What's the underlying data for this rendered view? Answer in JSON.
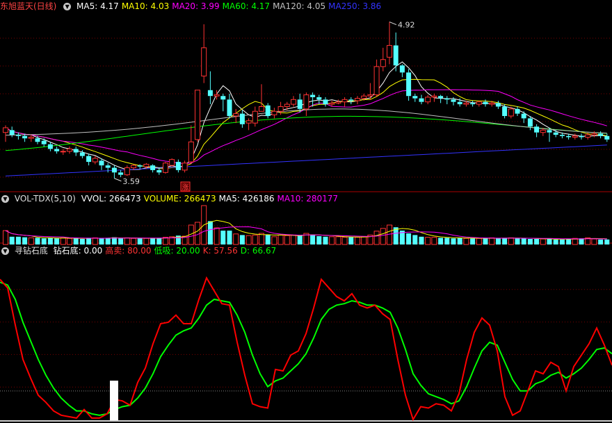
{
  "legends": {
    "main": {
      "stock": "东旭蓝天(日线)",
      "items": [
        {
          "label": "MA5:",
          "value": "4.17",
          "color": "#ffffff"
        },
        {
          "label": "MA10:",
          "value": "4.03",
          "color": "#ffff00"
        },
        {
          "label": "MA20:",
          "value": "3.99",
          "color": "#ff00ff"
        },
        {
          "label": "MA60:",
          "value": "4.17",
          "color": "#00ff00"
        },
        {
          "label": "MA120:",
          "value": "4.05",
          "color": "#c0c0c0"
        },
        {
          "label": "MA250:",
          "value": "3.86",
          "color": "#3333ff"
        }
      ]
    },
    "vol": {
      "name": "VOL-TDX(5,10)",
      "items": [
        {
          "label": "VVOL:",
          "value": "266473",
          "color": "#ffffff"
        },
        {
          "label": "VOLUME:",
          "value": "266473",
          "color": "#ffff00"
        },
        {
          "label": "MA5:",
          "value": "426186",
          "color": "#ffffff"
        },
        {
          "label": "MA10:",
          "value": "280177",
          "color": "#ff00ff"
        }
      ]
    },
    "ind": {
      "name": "寻钻石底",
      "items": [
        {
          "label": "钻石底:",
          "value": "0.00",
          "color": "#ffffff"
        },
        {
          "label": "高卖:",
          "value": "80.00",
          "color": "#ff3333"
        },
        {
          "label": "低吸:",
          "value": "20.00",
          "color": "#00ff00"
        },
        {
          "label": "K:",
          "value": "57.56",
          "color": "#ff3333"
        },
        {
          "label": "D:",
          "value": "66.67",
          "color": "#00ff00"
        }
      ]
    }
  },
  "annotations": {
    "high": "4.92",
    "low": "3.59",
    "zhang": "涨"
  },
  "colors": {
    "up": "#ff3232",
    "down": "#54ffff",
    "k": "#ff0000",
    "d": "#00ff00",
    "ma5": "#ffffff",
    "ma10": "#ffff00",
    "ma20": "#ff00ff",
    "ma60": "#00ff00",
    "ma120": "#c0c0c0",
    "ma250": "#3333ff"
  },
  "chart_data": {
    "type": "candlestick",
    "price_range": [
      3.5,
      5.0
    ],
    "candles": [
      [
        3.98,
        4.02,
        3.9,
        4.04
      ],
      [
        4.0,
        3.96,
        3.94,
        4.03
      ],
      [
        3.96,
        3.95,
        3.92,
        3.98
      ],
      [
        3.95,
        3.93,
        3.9,
        3.97
      ],
      [
        3.93,
        3.94,
        3.9,
        3.96
      ],
      [
        3.93,
        3.9,
        3.88,
        3.95
      ],
      [
        3.91,
        3.88,
        3.86,
        3.93
      ],
      [
        3.88,
        3.84,
        3.82,
        3.9
      ],
      [
        3.84,
        3.82,
        3.8,
        3.86
      ],
      [
        3.82,
        3.82,
        3.79,
        3.84
      ],
      [
        3.82,
        3.84,
        3.8,
        3.86
      ],
      [
        3.84,
        3.81,
        3.78,
        3.86
      ],
      [
        3.81,
        3.78,
        3.76,
        3.83
      ],
      [
        3.78,
        3.73,
        3.7,
        3.8
      ],
      [
        3.73,
        3.76,
        3.71,
        3.78
      ],
      [
        3.74,
        3.7,
        3.66,
        3.76
      ],
      [
        3.7,
        3.68,
        3.64,
        3.72
      ],
      [
        3.68,
        3.64,
        3.59,
        3.7
      ],
      [
        3.64,
        3.62,
        3.6,
        3.66
      ],
      [
        3.62,
        3.68,
        3.61,
        3.7
      ],
      [
        3.68,
        3.7,
        3.66,
        3.71
      ],
      [
        3.7,
        3.69,
        3.67,
        3.71
      ],
      [
        3.69,
        3.71,
        3.67,
        3.72
      ],
      [
        3.7,
        3.66,
        3.64,
        3.71
      ],
      [
        3.66,
        3.64,
        3.62,
        3.68
      ],
      [
        3.64,
        3.72,
        3.63,
        3.73
      ],
      [
        3.7,
        3.75,
        3.69,
        3.76
      ],
      [
        3.73,
        3.66,
        3.64,
        3.75
      ],
      [
        3.66,
        3.72,
        3.64,
        3.74
      ],
      [
        3.73,
        3.9,
        3.72,
        4.04
      ],
      [
        3.92,
        4.34,
        3.9,
        4.34
      ],
      [
        4.46,
        4.7,
        4.4,
        4.9
      ],
      [
        4.34,
        4.29,
        4.22,
        4.5
      ],
      [
        4.29,
        4.3,
        4.26,
        4.34
      ],
      [
        4.29,
        4.26,
        4.16,
        4.31
      ],
      [
        4.26,
        4.12,
        4.1,
        4.31
      ],
      [
        4.12,
        4.14,
        4.06,
        4.18
      ],
      [
        4.14,
        4.05,
        4.02,
        4.17
      ],
      [
        4.06,
        4.08,
        4.0,
        4.1
      ],
      [
        4.06,
        4.16,
        4.03,
        4.2
      ],
      [
        4.16,
        4.2,
        4.16,
        4.39
      ],
      [
        4.21,
        4.12,
        4.1,
        4.23
      ],
      [
        4.13,
        4.16,
        4.1,
        4.19
      ],
      [
        4.16,
        4.2,
        4.13,
        4.24
      ],
      [
        4.2,
        4.22,
        4.17,
        4.24
      ],
      [
        4.22,
        4.26,
        4.2,
        4.29
      ],
      [
        4.26,
        4.18,
        4.15,
        4.31
      ],
      [
        4.18,
        4.3,
        4.12,
        4.32
      ],
      [
        4.3,
        4.28,
        4.2,
        4.32
      ],
      [
        4.28,
        4.26,
        4.22,
        4.3
      ],
      [
        4.26,
        4.22,
        4.2,
        4.28
      ],
      [
        4.22,
        4.23,
        4.2,
        4.25
      ],
      [
        4.23,
        4.24,
        4.22,
        4.26
      ],
      [
        4.24,
        4.26,
        4.2,
        4.28
      ],
      [
        4.26,
        4.25,
        4.22,
        4.28
      ],
      [
        4.25,
        4.27,
        4.22,
        4.29
      ],
      [
        4.27,
        4.29,
        4.25,
        4.31
      ],
      [
        4.29,
        4.3,
        4.26,
        4.4
      ],
      [
        4.3,
        4.54,
        4.28,
        4.6
      ],
      [
        4.54,
        4.6,
        4.5,
        4.7
      ],
      [
        4.62,
        4.72,
        4.56,
        4.92
      ],
      [
        4.72,
        4.55,
        4.5,
        4.83
      ],
      [
        4.55,
        4.49,
        4.45,
        4.56
      ],
      [
        4.49,
        4.29,
        4.25,
        4.52
      ],
      [
        4.29,
        4.27,
        4.24,
        4.31
      ],
      [
        4.27,
        4.24,
        4.22,
        4.3
      ],
      [
        4.24,
        4.28,
        4.22,
        4.3
      ],
      [
        4.28,
        4.29,
        4.24,
        4.31
      ],
      [
        4.29,
        4.27,
        4.23,
        4.3
      ],
      [
        4.27,
        4.26,
        4.22,
        4.29
      ],
      [
        4.26,
        4.24,
        4.21,
        4.28
      ],
      [
        4.24,
        4.22,
        4.2,
        4.27
      ],
      [
        4.22,
        4.23,
        4.2,
        4.25
      ],
      [
        4.23,
        4.22,
        4.2,
        4.25
      ],
      [
        4.22,
        4.24,
        4.2,
        4.25
      ],
      [
        4.24,
        4.22,
        4.2,
        4.26
      ],
      [
        4.22,
        4.23,
        4.2,
        4.25
      ],
      [
        4.23,
        4.2,
        4.18,
        4.25
      ],
      [
        4.2,
        4.12,
        4.1,
        4.22
      ],
      [
        4.12,
        4.18,
        4.1,
        4.2
      ],
      [
        4.18,
        4.14,
        4.12,
        4.2
      ],
      [
        4.14,
        4.1,
        4.06,
        4.16
      ],
      [
        4.1,
        4.03,
        4.0,
        4.12
      ],
      [
        4.03,
        3.98,
        3.94,
        4.05
      ],
      [
        3.98,
        4.0,
        3.95,
        4.02
      ],
      [
        4.0,
        3.98,
        3.9,
        4.02
      ],
      [
        3.98,
        3.96,
        3.94,
        4.0
      ],
      [
        3.96,
        3.95,
        3.93,
        3.98
      ],
      [
        3.95,
        3.94,
        3.92,
        3.97
      ],
      [
        3.94,
        3.95,
        3.92,
        3.97
      ],
      [
        3.95,
        3.94,
        3.92,
        3.97
      ],
      [
        3.94,
        3.96,
        3.92,
        3.98
      ],
      [
        3.96,
        3.97,
        3.94,
        3.99
      ],
      [
        3.97,
        3.95,
        3.93,
        3.99
      ],
      [
        3.95,
        3.92,
        3.9,
        3.97
      ]
    ],
    "volume": [
      50,
      28,
      28,
      26,
      24,
      24,
      22,
      24,
      22,
      24,
      22,
      22,
      20,
      24,
      24,
      22,
      24,
      26,
      22,
      24,
      22,
      22,
      22,
      22,
      24,
      26,
      28,
      32,
      30,
      70,
      80,
      140,
      84,
      60,
      50,
      50,
      38,
      34,
      32,
      34,
      40,
      36,
      28,
      34,
      32,
      34,
      32,
      40,
      36,
      30,
      28,
      28,
      28,
      26,
      26,
      26,
      28,
      34,
      48,
      58,
      70,
      62,
      50,
      40,
      34,
      28,
      26,
      26,
      24,
      24,
      22,
      24,
      22,
      22,
      22,
      22,
      24,
      22,
      24,
      24,
      22,
      22,
      20,
      20,
      20,
      20,
      18,
      18,
      20,
      22,
      22,
      24,
      20,
      18,
      18
    ],
    "k": [
      98,
      92,
      66,
      42,
      29,
      17,
      12,
      6,
      3,
      2,
      1,
      7,
      1,
      1,
      4,
      14,
      13,
      10,
      26,
      36,
      53,
      67,
      68,
      73,
      67,
      67,
      84,
      99,
      90,
      81,
      80,
      54,
      31,
      11,
      9,
      8,
      35,
      34,
      45,
      48,
      60,
      78,
      98,
      92,
      86,
      83,
      88,
      80,
      78,
      80,
      74,
      70,
      42,
      17,
      0,
      9,
      8,
      11,
      10,
      6,
      18,
      42,
      61,
      71,
      66,
      48,
      16,
      3,
      6,
      20,
      34,
      32,
      40,
      37,
      20,
      37,
      45,
      53,
      64,
      52,
      38
    ],
    "d": [
      96,
      94,
      84,
      68,
      55,
      42,
      31,
      22,
      15,
      10,
      6,
      6,
      4,
      3,
      4,
      7,
      9,
      10,
      15,
      22,
      32,
      44,
      52,
      59,
      62,
      64,
      71,
      80,
      84,
      83,
      82,
      73,
      61,
      45,
      32,
      23,
      27,
      29,
      34,
      39,
      46,
      57,
      70,
      77,
      80,
      81,
      83,
      82,
      80,
      80,
      78,
      75,
      64,
      49,
      32,
      24,
      18,
      16,
      14,
      11,
      13,
      23,
      36,
      48,
      54,
      52,
      40,
      28,
      20,
      20,
      25,
      27,
      31,
      33,
      29,
      32,
      36,
      42,
      49,
      50,
      46
    ]
  }
}
